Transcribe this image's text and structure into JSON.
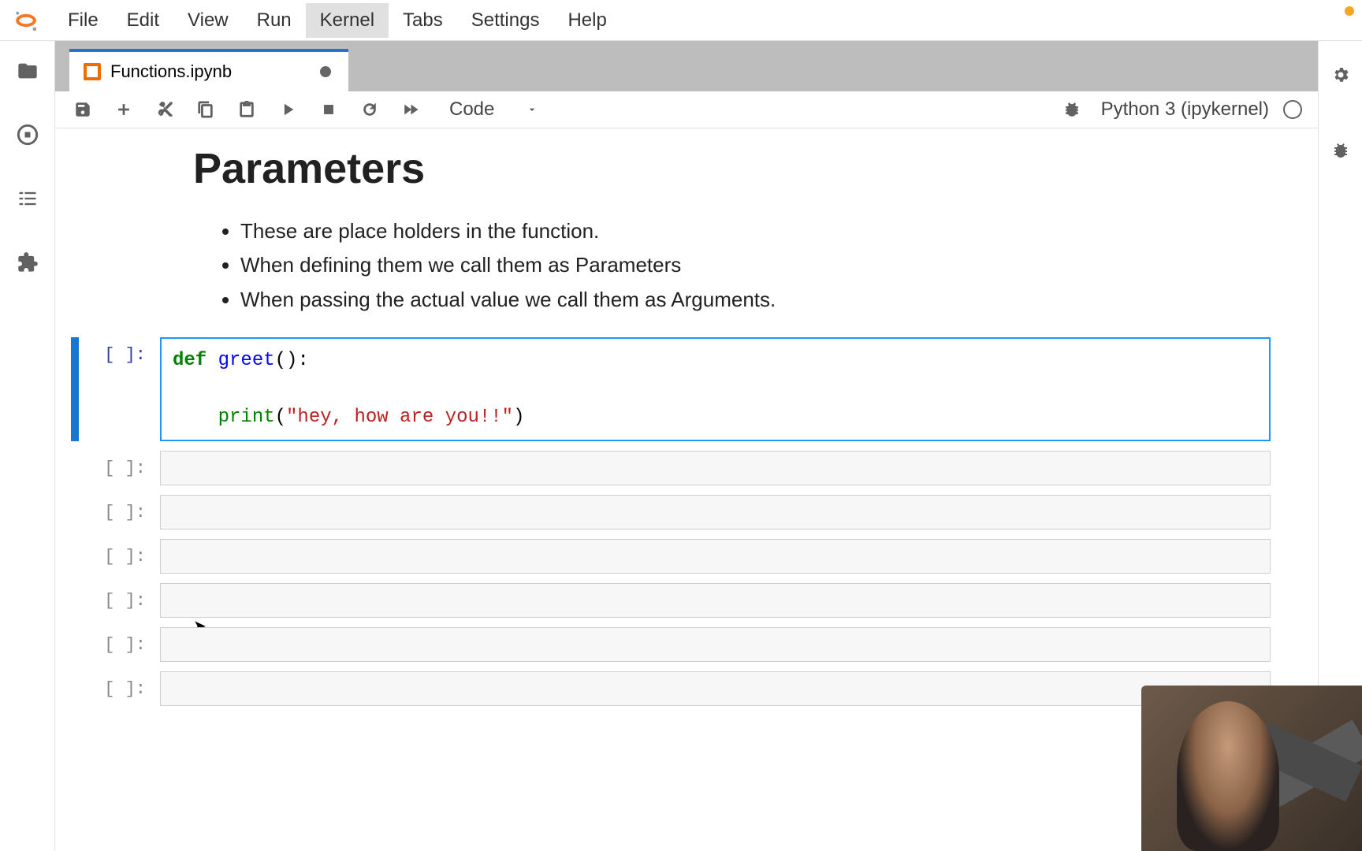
{
  "menubar": {
    "items": [
      "File",
      "Edit",
      "View",
      "Run",
      "Kernel",
      "Tabs",
      "Settings",
      "Help"
    ],
    "hovered_index": 4
  },
  "tab": {
    "filename": "Functions.ipynb"
  },
  "toolbar": {
    "cell_type": "Code",
    "kernel_name": "Python 3 (ipykernel)"
  },
  "markdown": {
    "heading": "Parameters",
    "bullets": [
      "These are place holders in the function.",
      "When defining them we call them as Parameters",
      "When passing the actual value we call them as Arguments."
    ]
  },
  "code_cell": {
    "prompt": "[ ]:",
    "tokens": {
      "kw_def": "def",
      "fn_name": "greet",
      "parens_colon": "():",
      "print_call": "print",
      "open_paren": "(",
      "string": "\"hey, how are you!!\"",
      "close_paren": ")"
    }
  },
  "empty_cells": {
    "prompt": "[ ]:",
    "count": 6
  }
}
